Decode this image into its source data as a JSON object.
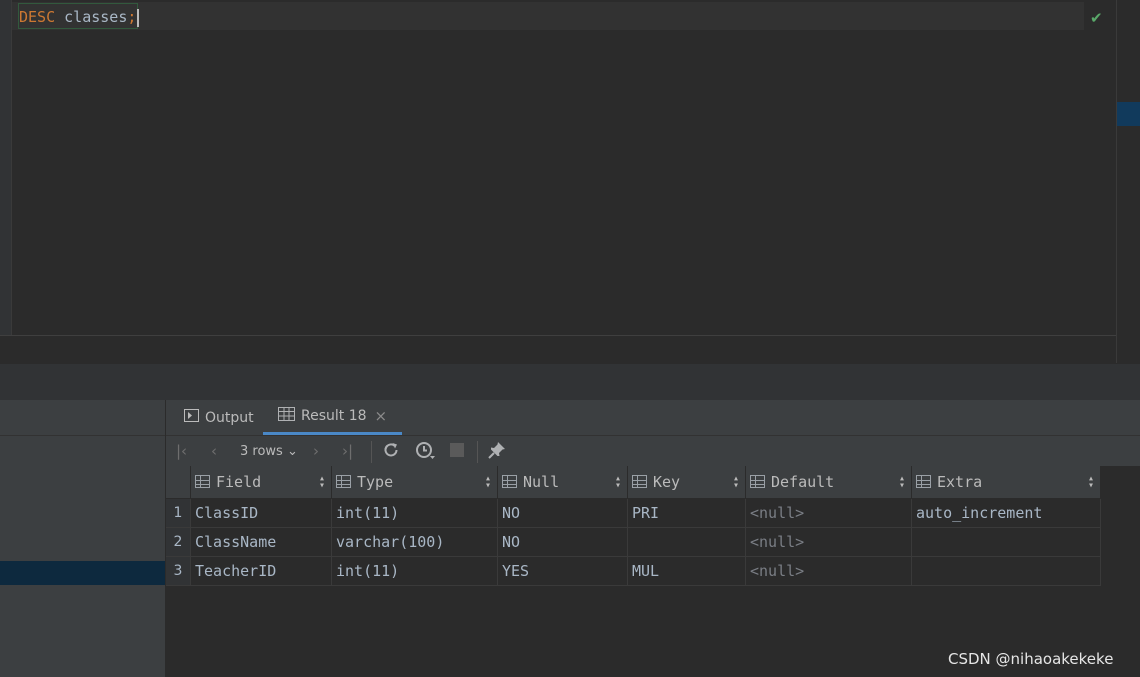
{
  "editor": {
    "keyword": "DESC",
    "table": "classes",
    "terminator": ";",
    "status_icon": "check-icon"
  },
  "result_tabs": [
    {
      "label": "Output",
      "icon": "console-icon"
    },
    {
      "label": "Result 18",
      "icon": "table-icon",
      "close": "×"
    }
  ],
  "toolbar": {
    "rows_label": "3 rows",
    "icons": [
      "first-page-icon",
      "prev-page-icon",
      "next-page-icon",
      "last-page-icon",
      "reload-icon",
      "history-icon",
      "stop-icon",
      "pin-icon"
    ]
  },
  "grid": {
    "columns": [
      "Field",
      "Type",
      "Null",
      "Key",
      "Default",
      "Extra"
    ],
    "rows": [
      {
        "num": "1",
        "cells": [
          "ClassID",
          "int(11)",
          "NO",
          "PRI",
          "<null>",
          "auto_increment"
        ]
      },
      {
        "num": "2",
        "cells": [
          "ClassName",
          "varchar(100)",
          "NO",
          "",
          "<null>",
          ""
        ]
      },
      {
        "num": "3",
        "cells": [
          "TeacherID",
          "int(11)",
          "YES",
          "MUL",
          "<null>",
          ""
        ]
      }
    ]
  },
  "watermark": "CSDN @nihaoakekeke",
  "colors": {
    "keyword": "#cc7832",
    "accent": "#4a88c7",
    "ok": "#59a869"
  }
}
